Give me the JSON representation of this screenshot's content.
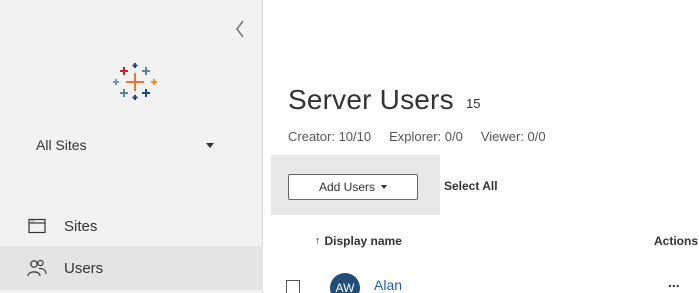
{
  "sidebar": {
    "collapse_icon": "chevron-left-icon",
    "logo_icon": "tableau-logo-icon",
    "site_selector": {
      "value": "All Sites",
      "icon": "caret-down-icon"
    },
    "nav": [
      {
        "label": "Sites",
        "icon": "window-icon",
        "active": false
      },
      {
        "label": "Users",
        "icon": "users-icon",
        "active": true
      }
    ]
  },
  "main": {
    "title": "Server Users",
    "count": "15",
    "licenses": [
      "Creator: 10/10",
      "Explorer: 0/0",
      "Viewer: 0/0"
    ],
    "toolbar": {
      "add_users_label": "Add Users",
      "select_all_label": "Select All"
    },
    "table": {
      "columns": {
        "display_name": "Display name",
        "sort_arrow": "↑",
        "actions": "Actions"
      },
      "rows": [
        {
          "initials": "AW",
          "name": "Alan",
          "actions": "..."
        }
      ]
    }
  },
  "colors": {
    "sidebar_bg": "#f2f2f2",
    "active_nav_bg": "#e4e4e4",
    "avatar_bg": "#1f4e79",
    "link": "#1f5fa8"
  }
}
